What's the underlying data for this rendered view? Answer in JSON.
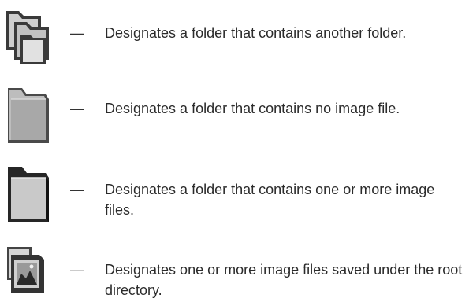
{
  "legend": {
    "dash": "—",
    "items": [
      {
        "icon": "folder-with-subfolder-icon",
        "text": "Designates a folder that contains another folder."
      },
      {
        "icon": "empty-folder-icon",
        "text": "Designates a folder that contains no image file."
      },
      {
        "icon": "folder-with-images-icon",
        "text": "Designates a folder that contains one or more image files."
      },
      {
        "icon": "image-file-icon",
        "text": "Designates one or more image files saved under the root directory."
      }
    ]
  }
}
